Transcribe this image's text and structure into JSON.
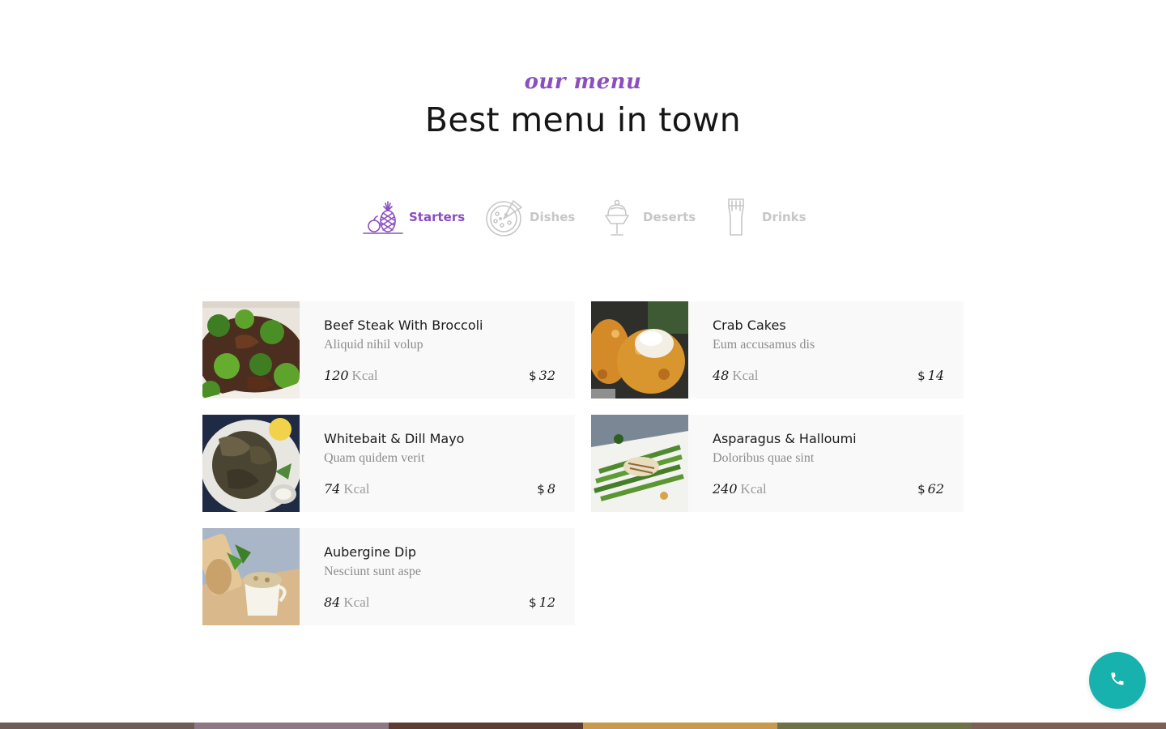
{
  "header": {
    "subtitle": "our menu",
    "title": "Best menu in town"
  },
  "tabs": [
    {
      "label": "Starters",
      "icon": "pineapple-apple-icon",
      "active": true
    },
    {
      "label": "Dishes",
      "icon": "pizza-icon",
      "active": false
    },
    {
      "label": "Deserts",
      "icon": "ice-cream-cup-icon",
      "active": false
    },
    {
      "label": "Drinks",
      "icon": "beer-glass-icon",
      "active": false
    }
  ],
  "menu_items": [
    {
      "name": "Beef Steak With Broccoli",
      "description": "Aliquid nihil volup",
      "kcal": "120",
      "kcal_unit": "Kcal",
      "currency": "$",
      "price": "32",
      "image": "beef-broccoli-photo"
    },
    {
      "name": "Crab Cakes",
      "description": "Eum accusamus dis",
      "kcal": "48",
      "kcal_unit": "Kcal",
      "currency": "$",
      "price": "14",
      "image": "crab-cakes-photo"
    },
    {
      "name": "Whitebait & Dill Mayo",
      "description": "Quam quidem verit",
      "kcal": "74",
      "kcal_unit": "Kcal",
      "currency": "$",
      "price": "8",
      "image": "whitebait-photo"
    },
    {
      "name": "Asparagus & Halloumi",
      "description": "Doloribus quae sint",
      "kcal": "240",
      "kcal_unit": "Kcal",
      "currency": "$",
      "price": "62",
      "image": "asparagus-halloumi-photo"
    },
    {
      "name": "Aubergine Dip",
      "description": "Nesciunt sunt aspe",
      "kcal": "84",
      "kcal_unit": "Kcal",
      "currency": "$",
      "price": "12",
      "image": "aubergine-dip-photo"
    }
  ],
  "call_button": {
    "icon": "phone-icon"
  },
  "colors": {
    "accent": "#8a4fc0",
    "inactive": "#c7c7c7",
    "call_button": "#17b2ad",
    "card_background": "#f9f9f9"
  }
}
